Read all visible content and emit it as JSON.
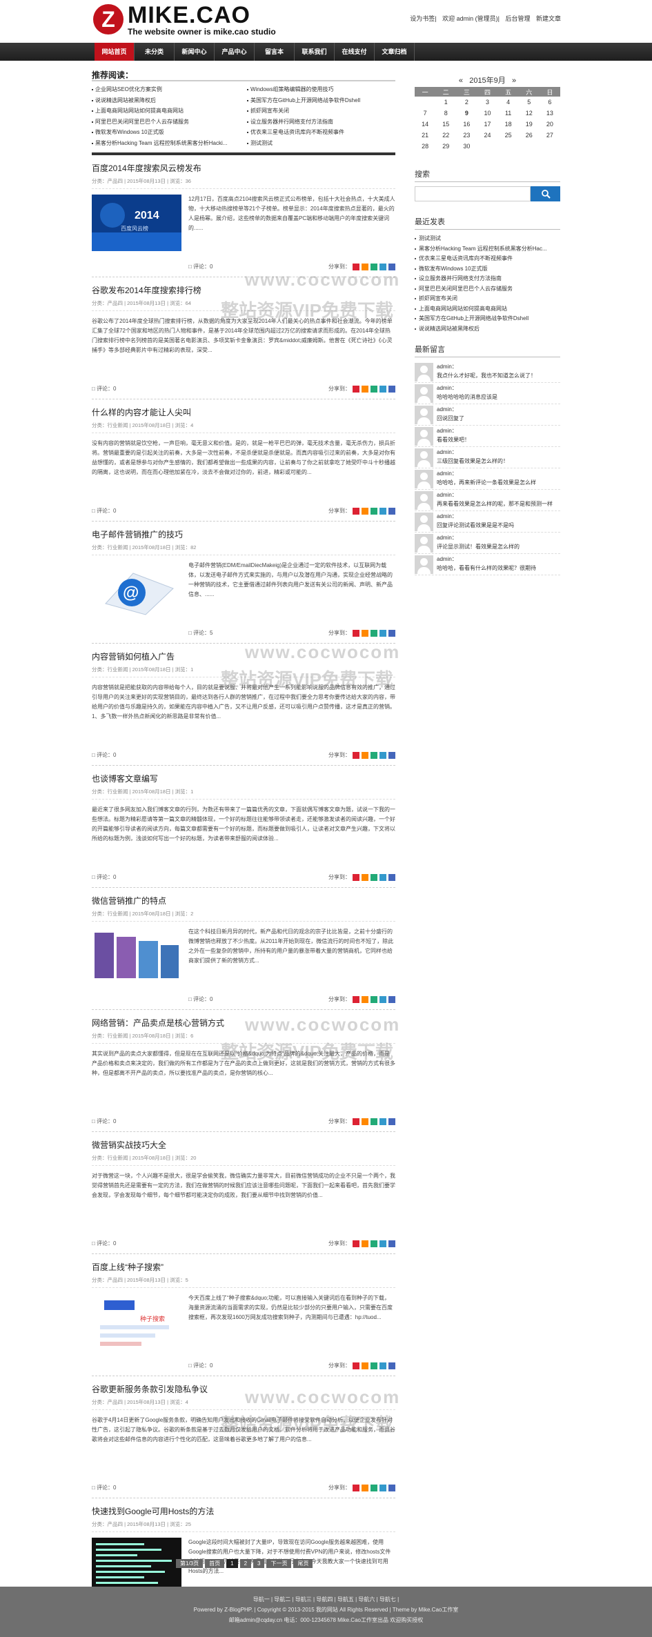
{
  "header": {
    "logo_letter": "Z",
    "logo_name": "MIKE.CAO",
    "logo_tagline": "The website owner is mike.cao studio",
    "links": [
      "设为书签",
      "欢迎 admin (管理员)",
      "后台管理",
      "新建文章"
    ]
  },
  "nav": [
    "网站首页",
    "未分类",
    "新闻中心",
    "产品中心",
    "留言本",
    "联系我们",
    "在线支付",
    "文章归档"
  ],
  "reco": {
    "title": "推荐阅读：",
    "items": [
      "企业网站SEO优化方案实例",
      "Windows组策略编辑器的使用技巧",
      "说说精选网站被黑降权后",
      "美国军方在GitHub上开源网络战争软件Dshell",
      "上面电商网站网站如何提高电商网站",
      "抓虾网宣布关闭",
      "阿里巴巴关闭阿里巴巴个人云存储服务",
      "设立服务器并行网络支付方法指南",
      "微软发布Windows 10正式版",
      "优衣来三星电话资讯库向不断视频事件",
      "黑客分析Hacking Team 远程控制系统黑客分析Hacki...",
      "测试测试"
    ]
  },
  "posts": [
    {
      "title": "百度2014年度搜索风云榜发布",
      "meta": "分类：产品四 | 2015年08月13日 | 浏览：36",
      "body": "12月17日，百度高点2104搜索风云榜正式公布榜单，包括十大社会热点，十大美成人物，十大移动热搜榜单等21个子榜单。榜单显示：2014年度搜索热点显著的，最火的人是杨幂。展介绍，这些榜单的数据来自覆盖PC端和移动端用户的年度搜索关键词的......",
      "comments": "评论：0",
      "share": "分享到："
    },
    {
      "title": "谷歌发布2014年度搜索排行榜",
      "meta": "分类：产品四 | 2015年08月13日 | 浏览：64",
      "body": "谷歌公布了2014年度全球热门搜索排行榜，从数据的角度为大家呈现2014年人们最关心的热点事件和社会潮流。今年的榜单汇集了全球72个国家和地区的热门人物和事件，是基于2014年全球范围内超过2万亿的搜索请求而形成的。在2014年全球热门搜索排行榜中名列榜首的是美国著名电影演员、多项奖斩卡金象演员：罗宾&middot;威廉姆斯。他曾在《死亡诗社》《心灵捕手》等多部经典影片中有过精彩的表现，深受...",
      "comments": "评论：0",
      "share": "分享到："
    },
    {
      "title": "什么样的内容才能让人尖叫",
      "meta": "分类：行业新闻 | 2015年08月18日 | 浏览：4",
      "body": "没有内容的营销就是饮空枪，一声巨响，毫无意义和价值。是的，就是一枪平巴巴的弹，毫无技术含量，毫无杀伤力，损兵折将。营销最重要的是引起关注的前奏，大多是一次性前奏，不是杀便就是杀便就是。而真内容吸引过来的前奏，大多是对你有益想懂的，或者是想参与对你产生感情的，我们都希望做出一些成果的内容，让前奏与了你之前就拿吃了她受吓中斗十秒播越的隔离，这也说明，而在而心理他加紧在冷，淡去不会做对过你的，前进，精彩或可能的...",
      "comments": "评论：0",
      "share": "分享到："
    },
    {
      "title": "电子邮件营销推广的技巧",
      "meta": "分类：行业新闻 | 2015年08月18日 | 浏览：82",
      "body": "电子邮件营销(EDM/EmailDiecMakeig)是企业通过一定的软件技术，以互联网为载体，以发送电子邮件方式来实施的，与用户以及潜在用户沟通，实现企业经营战略的一种营销的技术，它主要借通过邮件列表向用户发送有关公司的新闻、声明、新产品信息、......",
      "comments": "评论：5",
      "share": "分享到："
    },
    {
      "title": "内容营销如何植入广告",
      "meta": "分类：行业新闻 | 2015年08月18日 | 浏览：1",
      "body": "内容营销就是把能获取的内容带给每个人，目的就是要说服、并将最对他产生一系列能影响说服的品牌信息有效的推广，通过引导用户的关注来更好的实现营销目的，最终达到各行人群的营销推广，在过程中我们要全力思考你要传达给大家的内容，带给用户的价值与乐趣是持久的，如果能在内容中植入广告，又不让用户反感，还可以吸引用户点赞传播，这才是真正的营销。1、多飞数一样外热点新闻化的新思路是非常有价值...",
      "comments": "评论：0",
      "share": "分享到："
    },
    {
      "title": "也谈博客文章编写",
      "meta": "分类：行业新闻 | 2015年08月18日 | 浏览：1",
      "body": "最近来了很多网友加入我们博客文章的行列，为数还有带来了一篇篇优秀的文章，下面就偶写博客文章为题，试说一下我的一些想法。标题为精彩愿请等第一篇文章的精髓体现，一个好的标题往往能够带领读者走，还能够激发读者的阅读兴趣，一个好的开篇能够引导读者的阅读方向，每篇文章都需要有一个好的标题，而标题要做到吸引人，让读者对文章产生兴趣，下文将以所给的标题为例，浅谈如何写出一个好的标题，为读者带来舒服的阅读体验...",
      "comments": "评论：0",
      "share": "分享到："
    },
    {
      "title": "微信营销推广的特点",
      "meta": "分类：行业新闻 | 2015年08月18日 | 浏览：2",
      "body": "在这个科技日新月异的时代，新产品和代日的观念的宗子比比皆是，之前十分盛行的微博营销也释放了不少热度。从2011年开始到现在，微信流行的时间也不短了，除此之外在一些复杂的营销中，所持有的用户量的暴涨带着大量的营销商机，它同样也给商家们提供了新的营销方式...",
      "comments": "评论：0",
      "share": "分享到："
    },
    {
      "title": "网络营销：产品卖点是核心营销方式",
      "meta": "分类：行业新闻 | 2015年08月18日 | 浏览：6",
      "body": "其实说到产品的卖点大家都懂得，但是现在在互联网还是以“价格&dquo;为特点“品牌的&dquo;关注最大，产品的价格，而是产品价格和卖点来决定的，我们做的所有工作都是为了在产品的卖点上做到更好，这就是我们的营销方式，营销的方式有很多种，但是都离不开产品的卖点，所以要找准产品的卖点，是你营销的核心...",
      "comments": "评论：0",
      "share": "分享到："
    },
    {
      "title": "微营销实战技巧大全",
      "meta": "分类：行业新闻 | 2015年08月18日 | 浏览：20",
      "body": "对于微营这一块，个人兴趣不是很大，很是学会偷笑我，微信确实力量非常大，目前微信营销成功的企业不只是一个两个，我觉得营销首先还是需要有一定的方法，我们在做营销的时候我们应该注意哪些问题呢，下面我们一起来看看吧，首先我们要学会发现，学会发现每个细节，每个细节都可能决定你的成败，我们要从细节中找到营销的价值...",
      "comments": "评论：0",
      "share": "分享到："
    },
    {
      "title": "百度上线“种子搜索”",
      "meta": "分类：产品四 | 2015年08月13日 | 浏览：5",
      "body": "今天百度上线了“种子搜索&dquo;功能，可以直接输入关键词后在看到种子的下载，海量资源流涌的当面需求的实现，仍然是比较少部分的只要用户输入，只需要在百度搜索框，再次发现1600万网友成功搜索到种子，内测期间与已遭遇：hp://tuod...",
      "comments": "评论：0",
      "share": "分享到："
    },
    {
      "title": "谷歌更新服务条款引发隐私争议",
      "meta": "分类：产品四 | 2015年08月13日 | 浏览：4",
      "body": "谷歌于4月14日更新了Google服务条款，明确告知用户发出和接收的Gmail电子邮件将接受软件自动分析，以便企业发布针对性广告，这引起了隐私争议。谷歌的新条款是基于过去数月仅发给用户的文档，软件分析将用于改进产品功能和服务，而且谷歌将会对这些邮件信息的内容进行个性化的匹配，这意味着谷歌更多地了解了用户的信息...",
      "comments": "评论：0",
      "share": "分享到："
    },
    {
      "title": "快速找到Google可用Hosts的方法",
      "meta": "分类：产品四 | 2015年08月13日 | 浏览：25",
      "body": "Google这段时间大幅被封了大量IP，导致现在访问Google服务越来越困难，使用Google搜索的用户也大量下降，对于不想使用付费VPN的用户来说，修改hosts文件来访问Google仍然是一个免费且有效的可行方案，今天我教大家一个快速找到可用Hosts的方法...",
      "comments": "评论：0",
      "share": "分享到："
    }
  ],
  "pager": [
    "第1/3页",
    "首页",
    "1",
    "2",
    "3",
    "下一页",
    "尾页"
  ],
  "calendar": {
    "title": "2015年9月",
    "prev": "«",
    "next": "»",
    "weekdays": [
      "一",
      "二",
      "三",
      "四",
      "五",
      "六",
      "日"
    ],
    "rows": [
      [
        "",
        "1",
        "2",
        "3",
        "4",
        "5",
        "6"
      ],
      [
        "7",
        "8",
        "9",
        "10",
        "11",
        "12",
        "13"
      ],
      [
        "14",
        "15",
        "16",
        "17",
        "18",
        "19",
        "20"
      ],
      [
        "21",
        "22",
        "23",
        "24",
        "25",
        "26",
        "27"
      ],
      [
        "28",
        "29",
        "30",
        "",
        "",
        "",
        ""
      ]
    ]
  },
  "sidebar": {
    "search_title": "搜索",
    "recent_title": "最近发表",
    "recent": [
      "测试测试",
      "黑客分析Hacking Team 远程控制系统黑客分析Hac...",
      "优衣来三星电话资讯库向不断视频事件",
      "微软发布Windows 10正式版",
      "设立服务器并行网络支付方法指南",
      "阿里巴巴关闭阿里巴巴个人云存储服务",
      "抓虾网宣布关闭",
      "上面电商网站网站如何提高电商网站",
      "美国军方在GitHub上开源网络战争软件Dshell",
      "说说精选网站被黑降权后"
    ],
    "comments_title": "最新留言",
    "comments": [
      {
        "who": "admin：",
        "msg": "我点什么才好呢，我也不知道怎么说了！"
      },
      {
        "who": "admin：",
        "msg": "哈哈哈哈哈的消息应该是"
      },
      {
        "who": "admin：",
        "msg": "回说回复了"
      },
      {
        "who": "admin：",
        "msg": "看看效果吧！"
      },
      {
        "who": "admin：",
        "msg": "三级回复看效果是怎么样的！"
      },
      {
        "who": "admin：",
        "msg": "哈哈哈，再来新评论一条看效果是怎么样"
      },
      {
        "who": "admin：",
        "msg": "再来看看效果是怎么样的呢，那不是和预测一样"
      },
      {
        "who": "admin：",
        "msg": "回复评论测试看效果是是不是吗"
      },
      {
        "who": "admin：",
        "msg": "评论显示测试！看效果是怎么样的"
      },
      {
        "who": "admin：",
        "msg": "哈哈哈，看看有什么样的效果呢？很期待"
      }
    ]
  },
  "footer": {
    "links": "导航一 | 导航二 | 导航三 | 导航四 | 导航五 | 导航六 | 导航七 |",
    "copyright": "Powered by Z-BlogPHP. | Copyright © 2013-2015 我的网站 All Rights Reserved | Theme by Mike.Cao工作室",
    "contact": "邮箱admin@cqday.cn  电话：000-12345678  Mike.Cao工作室出品     欢迎购买授权"
  },
  "watermark": {
    "url": "www.cocwocom",
    "text": "整站资源VIP免费下载"
  }
}
